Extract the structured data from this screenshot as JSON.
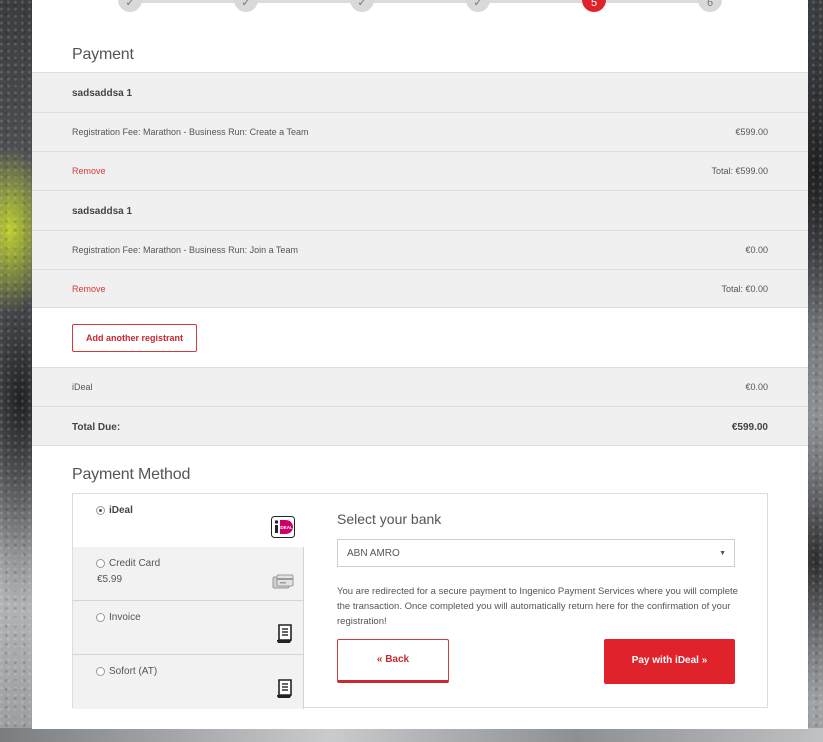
{
  "stepper": {
    "steps": [
      {
        "label": "✓"
      },
      {
        "label": "✓"
      },
      {
        "label": "✓"
      },
      {
        "label": "✓"
      },
      {
        "label": "5"
      },
      {
        "label": "6"
      }
    ],
    "active_step": 5
  },
  "payment": {
    "title": "Payment",
    "registrants": [
      {
        "name": "sadsaddsa 1",
        "fee_label": "Registration Fee: Marathon - Business Run: Create a Team",
        "fee_amount": "€599.00",
        "remove_label": "Remove",
        "total": "Total: €599.00"
      },
      {
        "name": "sadsaddsa 1",
        "fee_label": "Registration Fee: Marathon - Business Run: Join a Team",
        "fee_amount": "€0.00",
        "remove_label": "Remove",
        "total": "Total: €0.00"
      }
    ],
    "add_registrant_label": "Add another registrant",
    "method_fee": {
      "label": "iDeal",
      "amount": "€0.00"
    },
    "total_due": {
      "label": "Total Due:",
      "amount": "€599.00"
    }
  },
  "payment_method": {
    "title": "Payment Method",
    "options": [
      {
        "label": "iDeal",
        "sub": "",
        "icon": "ideal-logo-icon",
        "selected": true
      },
      {
        "label": "Credit Card",
        "sub": "€5.99",
        "icon": "credit-card-icon",
        "selected": false
      },
      {
        "label": "Invoice",
        "sub": "",
        "icon": "invoice-icon",
        "selected": false
      },
      {
        "label": "Sofort (AT)",
        "sub": "",
        "icon": "invoice-icon",
        "selected": false
      }
    ],
    "bank_title": "Select your bank",
    "bank_selected": "ABN AMRO",
    "redirect_text": "You are redirected for a secure payment to Ingenico Payment Services where you will complete the transaction. Once completed you will automatically return here for the confirmation of your registration!",
    "back_label": "« Back",
    "pay_label": "Pay with iDeal »"
  },
  "colors": {
    "accent": "#e0232b",
    "row_bg": "#f0f0f0",
    "ideal_pink": "#cc0066"
  }
}
